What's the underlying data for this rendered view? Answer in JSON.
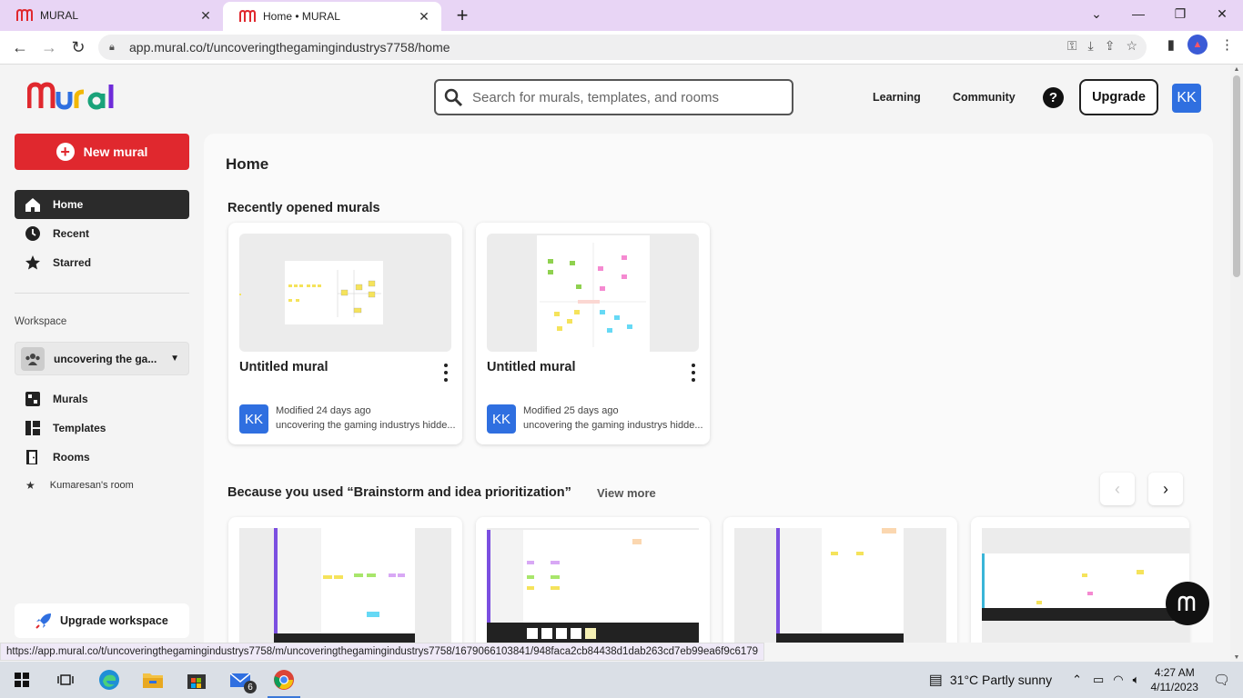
{
  "browser": {
    "tabs": [
      {
        "title": "MURAL",
        "active": false
      },
      {
        "title": "Home • MURAL",
        "active": true
      }
    ],
    "url": "app.mural.co/t/uncoveringthegamingindustrys7758/home",
    "status_url": "https://app.mural.co/t/uncoveringthegamingindustrys7758/m/uncoveringthegamingindustrys7758/1679066103841/948faca2cb84438d1dab263cd7eb99ea6f9c6179"
  },
  "header": {
    "search_placeholder": "Search for murals, templates, and rooms",
    "learning": "Learning",
    "community": "Community",
    "help": "?",
    "upgrade": "Upgrade",
    "avatar": "KK"
  },
  "sidebar": {
    "new_mural": "New mural",
    "nav": [
      {
        "label": "Home",
        "icon": "home-icon",
        "active": true
      },
      {
        "label": "Recent",
        "icon": "clock-icon"
      },
      {
        "label": "Starred",
        "icon": "star-icon"
      }
    ],
    "workspace_label": "Workspace",
    "workspace_name": "uncovering the ga...",
    "ws_nav": [
      {
        "label": "Murals",
        "icon": "murals-icon"
      },
      {
        "label": "Templates",
        "icon": "templates-icon"
      },
      {
        "label": "Rooms",
        "icon": "rooms-icon"
      }
    ],
    "room": "Kumaresan's room",
    "upgrade_workspace": "Upgrade workspace"
  },
  "main": {
    "title": "Home",
    "recent_title": "Recently opened murals",
    "recent": [
      {
        "title": "Untitled mural",
        "modified": "Modified 24 days ago",
        "workspace": "uncovering the gaming industrys hidde...",
        "avatar": "KK"
      },
      {
        "title": "Untitled mural",
        "modified": "Modified 25 days ago",
        "workspace": "uncovering the gaming industrys hidde...",
        "avatar": "KK"
      }
    ],
    "because_title": "Because you used  “Brainstorm and idea prioritization”",
    "view_more": "View more"
  },
  "taskbar": {
    "mail_badge": "6",
    "weather": "31°C  Partly sunny",
    "time": "4:27 AM",
    "date": "4/11/2023"
  },
  "colors": {
    "accent_red": "#e0282e",
    "avatar_blue": "#2f6fe0",
    "tab_bg": "#e8d5f5"
  }
}
